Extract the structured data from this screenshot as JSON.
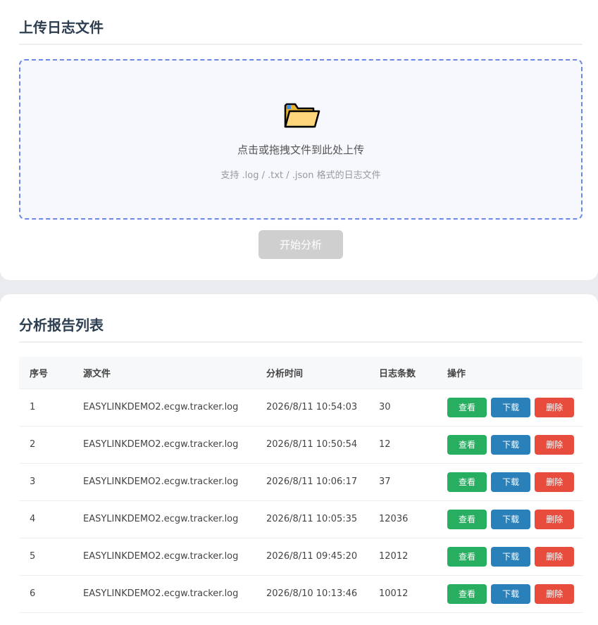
{
  "upload": {
    "title": "上传日志文件",
    "dropzone": {
      "icon": "folder-icon",
      "main_text": "点击或拖拽文件到此处上传",
      "sub_text": "支持 .log / .txt / .json 格式的日志文件"
    },
    "start_button": "开始分析"
  },
  "reports": {
    "title": "分析报告列表",
    "columns": [
      "序号",
      "源文件",
      "分析时间",
      "日志条数",
      "操作"
    ],
    "actions": {
      "view": "查看",
      "download": "下载",
      "delete": "删除"
    },
    "rows": [
      {
        "index": "1",
        "file": "EASYLINKDEMO2.ecgw.tracker.log",
        "time": "2026/8/11 10:54:03",
        "count": "30"
      },
      {
        "index": "2",
        "file": "EASYLINKDEMO2.ecgw.tracker.log",
        "time": "2026/8/11 10:50:54",
        "count": "12"
      },
      {
        "index": "3",
        "file": "EASYLINKDEMO2.ecgw.tracker.log",
        "time": "2026/8/11 10:06:17",
        "count": "37"
      },
      {
        "index": "4",
        "file": "EASYLINKDEMO2.ecgw.tracker.log",
        "time": "2026/8/11 10:05:35",
        "count": "12036"
      },
      {
        "index": "5",
        "file": "EASYLINKDEMO2.ecgw.tracker.log",
        "time": "2026/8/11 09:45:20",
        "count": "12012"
      },
      {
        "index": "6",
        "file": "EASYLINKDEMO2.ecgw.tracker.log",
        "time": "2026/8/10 10:13:46",
        "count": "10012"
      }
    ]
  },
  "colors": {
    "accent": "#6b86e6",
    "view": "#27ae60",
    "download": "#2a80b9",
    "delete": "#e74c3c",
    "disabled": "#cfcfcf"
  }
}
